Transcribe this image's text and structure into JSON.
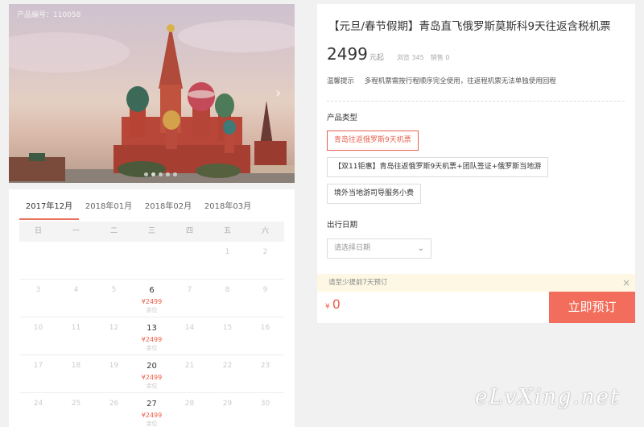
{
  "photo": {
    "product_code": "产品编号：110058",
    "next_arrow": "chevron-right-icon",
    "slides": 5,
    "active_slide": 1
  },
  "calendar": {
    "tabs": [
      "2017年12月",
      "2018年01月",
      "2018年02月",
      "2018年03月"
    ],
    "active_tab": 0,
    "weekdays": [
      "日",
      "一",
      "二",
      "三",
      "四",
      "五",
      "六"
    ],
    "weeks": [
      [
        {
          "d": ""
        },
        {
          "d": ""
        },
        {
          "d": ""
        },
        {
          "d": ""
        },
        {
          "d": ""
        },
        {
          "d": "1"
        },
        {
          "d": "2"
        }
      ],
      [
        {
          "d": "3"
        },
        {
          "d": "4"
        },
        {
          "d": "5"
        },
        {
          "d": "6",
          "p": "¥2499",
          "s": "余位"
        },
        {
          "d": "7"
        },
        {
          "d": "8"
        },
        {
          "d": "9"
        }
      ],
      [
        {
          "d": "10"
        },
        {
          "d": "11"
        },
        {
          "d": "12"
        },
        {
          "d": "13",
          "p": "¥2499",
          "s": "余位"
        },
        {
          "d": "14"
        },
        {
          "d": "15"
        },
        {
          "d": "16"
        }
      ],
      [
        {
          "d": "17"
        },
        {
          "d": "18"
        },
        {
          "d": "19"
        },
        {
          "d": "20",
          "p": "¥2499",
          "s": "余位"
        },
        {
          "d": "21"
        },
        {
          "d": "22"
        },
        {
          "d": "23"
        }
      ],
      [
        {
          "d": "24"
        },
        {
          "d": "25"
        },
        {
          "d": "26"
        },
        {
          "d": "27",
          "p": "¥2499",
          "s": "余位"
        },
        {
          "d": "28"
        },
        {
          "d": "29"
        },
        {
          "d": "30"
        }
      ]
    ]
  },
  "product": {
    "title": "【元旦/春节假期】青岛直飞俄罗斯莫斯科9天往返含税机票",
    "price": "2499",
    "price_unit": "元起",
    "views": "浏览 345",
    "sales": "销售 0",
    "tip_label": "温馨提示",
    "tip_text": "多程机票需按行程顺序完全使用，往返程机票无法单独使用回程"
  },
  "options": {
    "label": "产品类型",
    "items": [
      "青岛往返俄罗斯9天机票",
      "【双11钜惠】青岛往返俄罗斯9天机票+团队签证+俄罗斯当地游",
      "境外当地游司导服务小费"
    ],
    "selected": 0
  },
  "date_field": {
    "label": "出行日期",
    "placeholder": "请选择日期"
  },
  "notice": {
    "text": "请至少提前7天预订",
    "close": "×"
  },
  "order": {
    "currency": "¥",
    "total": "0",
    "book_label": "立即预订"
  },
  "watermark": "eLvXing.net",
  "colors": {
    "accent": "#f26d5b",
    "price_red": "#f05c45"
  }
}
